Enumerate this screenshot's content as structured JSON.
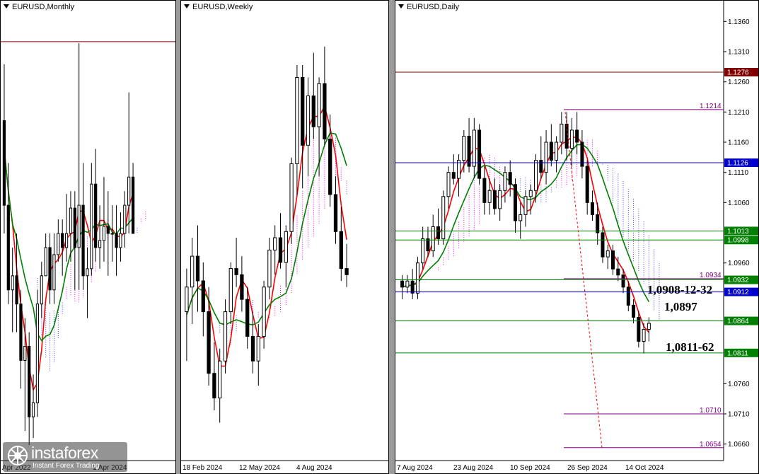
{
  "colors": {
    "bull": "#ffffff",
    "bear": "#000000",
    "tenkan": "#ff0000",
    "kijun": "#008000",
    "senkouA": "#ff00ff",
    "senkouB": "#4040ff",
    "chikou": "#808080"
  },
  "chart_data": [
    {
      "type": "candlestick",
      "title": "EURUSD,Monthly",
      "x_tick_labels": [
        "Apr 2022",
        "1 Apr 2024"
      ],
      "ylim": [
        0.94,
        1.26
      ],
      "horizontal_lines": [
        1.236
      ],
      "candles": [
        {
          "o": 1.18,
          "h": 1.22,
          "l": 1.1,
          "c": 1.12
        },
        {
          "o": 1.12,
          "h": 1.15,
          "l": 1.05,
          "c": 1.06
        },
        {
          "o": 1.06,
          "h": 1.09,
          "l": 1.03,
          "c": 1.07
        },
        {
          "o": 1.07,
          "h": 1.1,
          "l": 1.03,
          "c": 1.05
        },
        {
          "o": 1.05,
          "h": 1.06,
          "l": 0.99,
          "c": 1.01
        },
        {
          "o": 1.01,
          "h": 1.04,
          "l": 0.96,
          "c": 1.02
        },
        {
          "o": 1.02,
          "h": 1.03,
          "l": 0.95,
          "c": 0.97
        },
        {
          "o": 0.97,
          "h": 1.0,
          "l": 0.955,
          "c": 0.98
        },
        {
          "o": 0.98,
          "h": 1.06,
          "l": 0.97,
          "c": 1.05
        },
        {
          "o": 1.05,
          "h": 1.08,
          "l": 1.04,
          "c": 1.07
        },
        {
          "o": 1.07,
          "h": 1.1,
          "l": 1.07,
          "c": 1.09
        },
        {
          "o": 1.09,
          "h": 1.1,
          "l": 1.05,
          "c": 1.06
        },
        {
          "o": 1.06,
          "h": 1.1,
          "l": 1.05,
          "c": 1.085
        },
        {
          "o": 1.085,
          "h": 1.11,
          "l": 1.08,
          "c": 1.1
        },
        {
          "o": 1.1,
          "h": 1.11,
          "l": 1.07,
          "c": 1.09
        },
        {
          "o": 1.09,
          "h": 1.128,
          "l": 1.08,
          "c": 1.1
        },
        {
          "o": 1.1,
          "h": 1.13,
          "l": 1.08,
          "c": 1.118
        },
        {
          "o": 1.118,
          "h": 1.13,
          "l": 1.06,
          "c": 1.09
        },
        {
          "o": 1.09,
          "h": 1.235,
          "l": 1.06,
          "c": 1.12
        },
        {
          "o": 1.12,
          "h": 1.15,
          "l": 1.06,
          "c": 1.07
        },
        {
          "o": 1.07,
          "h": 1.09,
          "l": 1.04,
          "c": 1.075
        },
        {
          "o": 1.075,
          "h": 1.15,
          "l": 1.07,
          "c": 1.135
        },
        {
          "o": 1.135,
          "h": 1.16,
          "l": 1.08,
          "c": 1.09
        },
        {
          "o": 1.09,
          "h": 1.12,
          "l": 1.075,
          "c": 1.095
        },
        {
          "o": 1.095,
          "h": 1.14,
          "l": 1.08,
          "c": 1.105
        },
        {
          "o": 1.105,
          "h": 1.13,
          "l": 1.07,
          "c": 1.1
        },
        {
          "o": 1.1,
          "h": 1.12,
          "l": 1.08,
          "c": 1.1
        },
        {
          "o": 1.1,
          "h": 1.12,
          "l": 1.07,
          "c": 1.09
        },
        {
          "o": 1.09,
          "h": 1.115,
          "l": 1.08,
          "c": 1.1
        },
        {
          "o": 1.1,
          "h": 1.13,
          "l": 1.09,
          "c": 1.12
        },
        {
          "o": 1.12,
          "h": 1.2,
          "l": 1.1,
          "c": 1.14
        },
        {
          "o": 1.14,
          "h": 1.15,
          "l": 1.1,
          "c": 1.1
        }
      ]
    },
    {
      "type": "candlestick",
      "title": "EURUSD,Weekly",
      "x_tick_labels": [
        "18 Feb 2024",
        "12 May 2024",
        "4 Aug 2024"
      ],
      "ylim": [
        1.055,
        1.125
      ],
      "candles": [
        {
          "o": 1.078,
          "h": 1.085,
          "l": 1.07,
          "c": 1.082
        },
        {
          "o": 1.082,
          "h": 1.09,
          "l": 1.076,
          "c": 1.087
        },
        {
          "o": 1.087,
          "h": 1.092,
          "l": 1.078,
          "c": 1.083
        },
        {
          "o": 1.083,
          "h": 1.086,
          "l": 1.074,
          "c": 1.078
        },
        {
          "o": 1.078,
          "h": 1.082,
          "l": 1.066,
          "c": 1.068
        },
        {
          "o": 1.068,
          "h": 1.073,
          "l": 1.062,
          "c": 1.064
        },
        {
          "o": 1.064,
          "h": 1.072,
          "l": 1.06,
          "c": 1.07
        },
        {
          "o": 1.07,
          "h": 1.08,
          "l": 1.068,
          "c": 1.078
        },
        {
          "o": 1.078,
          "h": 1.086,
          "l": 1.076,
          "c": 1.085
        },
        {
          "o": 1.085,
          "h": 1.09,
          "l": 1.082,
          "c": 1.084
        },
        {
          "o": 1.084,
          "h": 1.087,
          "l": 1.078,
          "c": 1.08
        },
        {
          "o": 1.08,
          "h": 1.082,
          "l": 1.072,
          "c": 1.074
        },
        {
          "o": 1.074,
          "h": 1.078,
          "l": 1.068,
          "c": 1.07
        },
        {
          "o": 1.07,
          "h": 1.076,
          "l": 1.066,
          "c": 1.074
        },
        {
          "o": 1.074,
          "h": 1.083,
          "l": 1.072,
          "c": 1.082
        },
        {
          "o": 1.082,
          "h": 1.09,
          "l": 1.08,
          "c": 1.088
        },
        {
          "o": 1.088,
          "h": 1.092,
          "l": 1.084,
          "c": 1.09
        },
        {
          "o": 1.09,
          "h": 1.094,
          "l": 1.085,
          "c": 1.086
        },
        {
          "o": 1.086,
          "h": 1.092,
          "l": 1.082,
          "c": 1.091
        },
        {
          "o": 1.091,
          "h": 1.103,
          "l": 1.089,
          "c": 1.102
        },
        {
          "o": 1.102,
          "h": 1.118,
          "l": 1.097,
          "c": 1.116
        },
        {
          "o": 1.116,
          "h": 1.118,
          "l": 1.098,
          "c": 1.105
        },
        {
          "o": 1.105,
          "h": 1.116,
          "l": 1.1,
          "c": 1.113
        },
        {
          "o": 1.113,
          "h": 1.12,
          "l": 1.106,
          "c": 1.108
        },
        {
          "o": 1.108,
          "h": 1.116,
          "l": 1.1,
          "c": 1.115
        },
        {
          "o": 1.115,
          "h": 1.121,
          "l": 1.105,
          "c": 1.106
        },
        {
          "o": 1.106,
          "h": 1.11,
          "l": 1.095,
          "c": 1.097
        },
        {
          "o": 1.097,
          "h": 1.1,
          "l": 1.089,
          "c": 1.091
        },
        {
          "o": 1.091,
          "h": 1.095,
          "l": 1.083,
          "c": 1.085
        },
        {
          "o": 1.085,
          "h": 1.089,
          "l": 1.082,
          "c": 1.084
        }
      ]
    },
    {
      "type": "candlestick",
      "title": "EURUSD,Daily",
      "x_tick_labels": [
        "7 Aug 2024",
        "23 Aug 2024",
        "10 Sep 2024",
        "26 Sep 2024",
        "14 Oct 2024"
      ],
      "y_tick_labels": [
        "1.1360",
        "1.1310",
        "1.1260",
        "1.1210",
        "1.1160",
        "1.1110",
        "1.1060",
        "1.0960",
        "1.0760",
        "1.0710",
        "1.0660"
      ],
      "ylim": [
        1.0635,
        1.1385
      ],
      "price_labels": [
        {
          "value": "1.1276",
          "color": "#800000"
        },
        {
          "value": "1.1126",
          "color": "#0000cc"
        },
        {
          "value": "1.1013",
          "color": "#008000"
        },
        {
          "value": "1.0998",
          "color": "#008000"
        },
        {
          "value": "1.0932",
          "color": "#008000"
        },
        {
          "value": "1.0912",
          "color": "#0000cc"
        },
        {
          "value": "1.0864",
          "color": "#008000"
        },
        {
          "value": "1.0811",
          "color": "#008000"
        }
      ],
      "level_labels": [
        "1.1214",
        "1.0934",
        "1.0710",
        "1.0654"
      ],
      "annotations": [
        "1,0908-12-32",
        "1,0897",
        "1,0811-62"
      ],
      "candles": [
        {
          "o": 1.093,
          "h": 1.094,
          "l": 1.09,
          "c": 1.092
        },
        {
          "o": 1.092,
          "h": 1.094,
          "l": 1.091,
          "c": 1.093
        },
        {
          "o": 1.093,
          "h": 1.095,
          "l": 1.09,
          "c": 1.091
        },
        {
          "o": 1.091,
          "h": 1.097,
          "l": 1.09,
          "c": 1.096
        },
        {
          "o": 1.096,
          "h": 1.102,
          "l": 1.095,
          "c": 1.1
        },
        {
          "o": 1.1,
          "h": 1.102,
          "l": 1.097,
          "c": 1.098
        },
        {
          "o": 1.098,
          "h": 1.104,
          "l": 1.097,
          "c": 1.102
        },
        {
          "o": 1.102,
          "h": 1.105,
          "l": 1.099,
          "c": 1.1
        },
        {
          "o": 1.1,
          "h": 1.108,
          "l": 1.099,
          "c": 1.107
        },
        {
          "o": 1.107,
          "h": 1.112,
          "l": 1.105,
          "c": 1.111
        },
        {
          "o": 1.111,
          "h": 1.114,
          "l": 1.109,
          "c": 1.11
        },
        {
          "o": 1.11,
          "h": 1.114,
          "l": 1.107,
          "c": 1.113
        },
        {
          "o": 1.113,
          "h": 1.118,
          "l": 1.111,
          "c": 1.117
        },
        {
          "o": 1.117,
          "h": 1.12,
          "l": 1.111,
          "c": 1.112
        },
        {
          "o": 1.112,
          "h": 1.12,
          "l": 1.11,
          "c": 1.118
        },
        {
          "o": 1.118,
          "h": 1.119,
          "l": 1.109,
          "c": 1.11
        },
        {
          "o": 1.11,
          "h": 1.112,
          "l": 1.104,
          "c": 1.106
        },
        {
          "o": 1.106,
          "h": 1.11,
          "l": 1.104,
          "c": 1.108
        },
        {
          "o": 1.108,
          "h": 1.11,
          "l": 1.104,
          "c": 1.105
        },
        {
          "o": 1.105,
          "h": 1.109,
          "l": 1.103,
          "c": 1.108
        },
        {
          "o": 1.108,
          "h": 1.112,
          "l": 1.106,
          "c": 1.111
        },
        {
          "o": 1.111,
          "h": 1.113,
          "l": 1.107,
          "c": 1.109
        },
        {
          "o": 1.109,
          "h": 1.11,
          "l": 1.101,
          "c": 1.103
        },
        {
          "o": 1.103,
          "h": 1.106,
          "l": 1.1,
          "c": 1.104
        },
        {
          "o": 1.104,
          "h": 1.108,
          "l": 1.102,
          "c": 1.107
        },
        {
          "o": 1.107,
          "h": 1.109,
          "l": 1.104,
          "c": 1.108
        },
        {
          "o": 1.108,
          "h": 1.114,
          "l": 1.106,
          "c": 1.113
        },
        {
          "o": 1.113,
          "h": 1.117,
          "l": 1.11,
          "c": 1.111
        },
        {
          "o": 1.111,
          "h": 1.118,
          "l": 1.109,
          "c": 1.116
        },
        {
          "o": 1.116,
          "h": 1.119,
          "l": 1.112,
          "c": 1.113
        },
        {
          "o": 1.113,
          "h": 1.117,
          "l": 1.111,
          "c": 1.116
        },
        {
          "o": 1.116,
          "h": 1.121,
          "l": 1.114,
          "c": 1.119
        },
        {
          "o": 1.119,
          "h": 1.121,
          "l": 1.113,
          "c": 1.115
        },
        {
          "o": 1.115,
          "h": 1.12,
          "l": 1.112,
          "c": 1.118
        },
        {
          "o": 1.118,
          "h": 1.121,
          "l": 1.114,
          "c": 1.116
        },
        {
          "o": 1.116,
          "h": 1.118,
          "l": 1.11,
          "c": 1.112
        },
        {
          "o": 1.112,
          "h": 1.113,
          "l": 1.104,
          "c": 1.106
        },
        {
          "o": 1.106,
          "h": 1.108,
          "l": 1.103,
          "c": 1.104
        },
        {
          "o": 1.104,
          "h": 1.106,
          "l": 1.099,
          "c": 1.101
        },
        {
          "o": 1.101,
          "h": 1.102,
          "l": 1.096,
          "c": 1.097
        },
        {
          "o": 1.097,
          "h": 1.099,
          "l": 1.095,
          "c": 1.098
        },
        {
          "o": 1.098,
          "h": 1.099,
          "l": 1.094,
          "c": 1.095
        },
        {
          "o": 1.095,
          "h": 1.097,
          "l": 1.093,
          "c": 1.094
        },
        {
          "o": 1.094,
          "h": 1.095,
          "l": 1.091,
          "c": 1.092
        },
        {
          "o": 1.092,
          "h": 1.093,
          "l": 1.088,
          "c": 1.089
        },
        {
          "o": 1.089,
          "h": 1.09,
          "l": 1.086,
          "c": 1.087
        },
        {
          "o": 1.087,
          "h": 1.088,
          "l": 1.082,
          "c": 1.083
        },
        {
          "o": 1.083,
          "h": 1.086,
          "l": 1.081,
          "c": 1.085
        },
        {
          "o": 1.085,
          "h": 1.087,
          "l": 1.083,
          "c": 1.086
        }
      ]
    }
  ],
  "watermark": {
    "brand": "instaforex",
    "tagline": "Instant Forex Trading"
  }
}
